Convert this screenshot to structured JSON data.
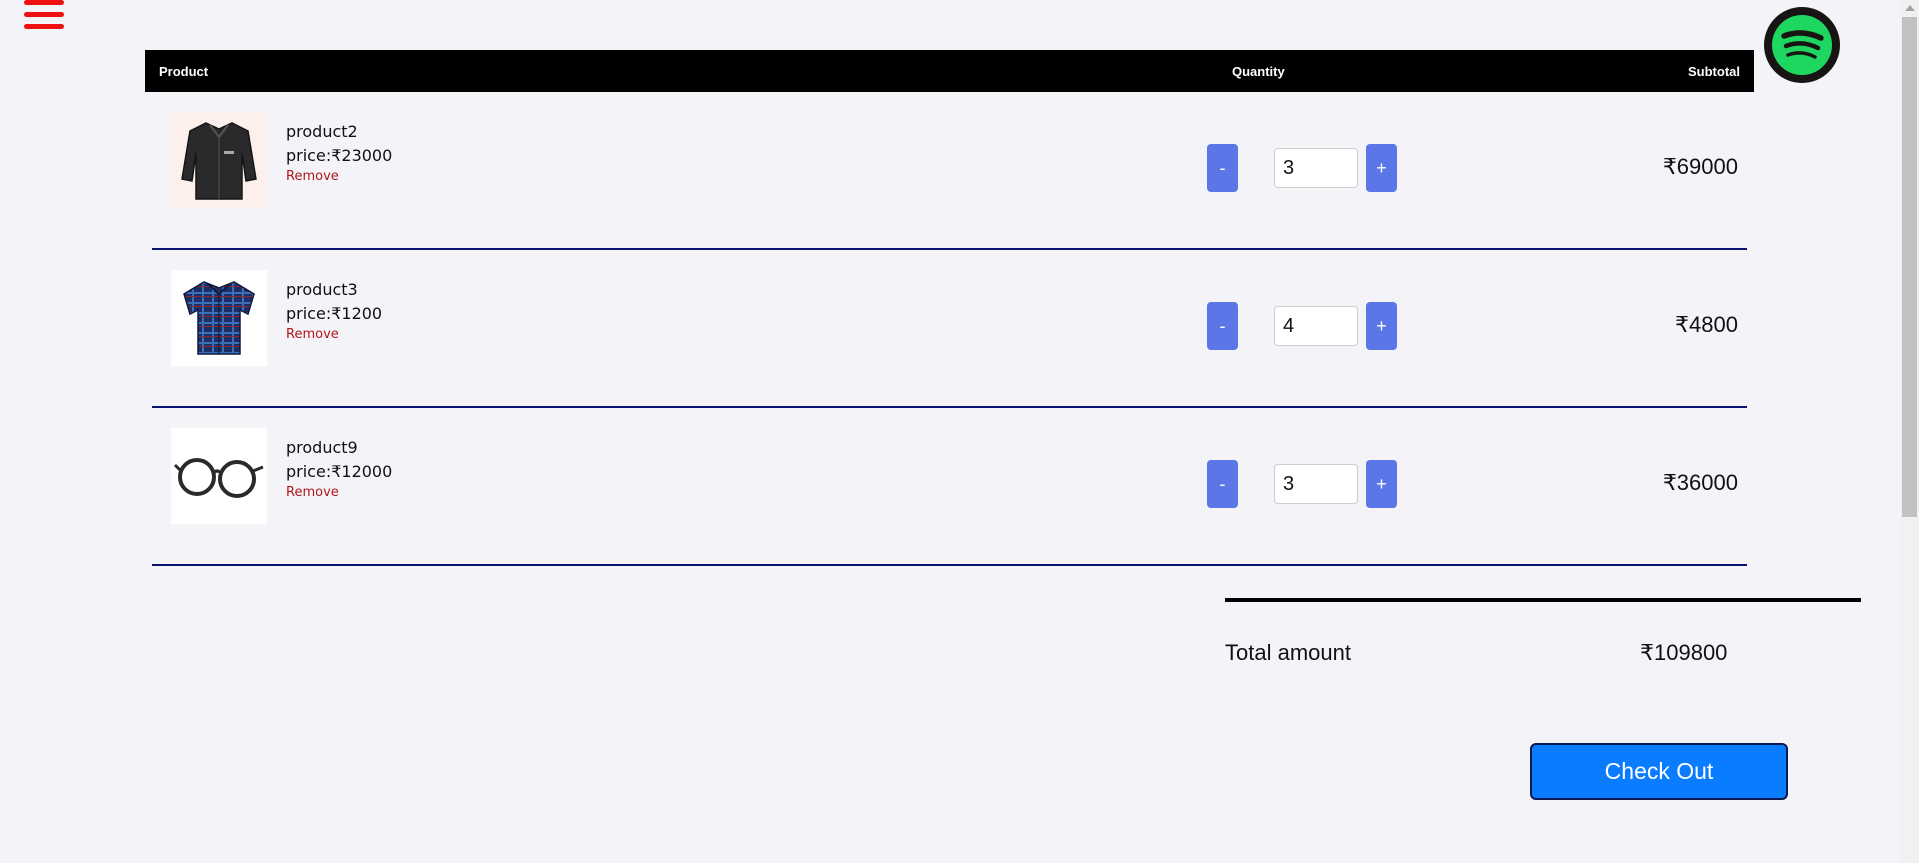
{
  "nav": {
    "menu_icon": "hamburger-menu-icon",
    "menu_color": "#ee1111",
    "spotify_icon": "spotify-logo-icon",
    "spotify_color": "#1ed760"
  },
  "table": {
    "headers": {
      "product": "Product",
      "quantity": "Quantity",
      "subtotal": "Subtotal"
    },
    "rows": [
      {
        "name": "product2",
        "price": "price:₹23000",
        "remove": "Remove",
        "image_icon": "jacket-image",
        "minus": "-",
        "plus": "+",
        "quantity": "3",
        "subtotal": "₹69000"
      },
      {
        "name": "product3",
        "price": "price:₹1200",
        "remove": "Remove",
        "image_icon": "plaid-shirt-image",
        "minus": "-",
        "plus": "+",
        "quantity": "4",
        "subtotal": "₹4800"
      },
      {
        "name": "product9",
        "price": "price:₹12000",
        "remove": "Remove",
        "image_icon": "eyeglasses-image",
        "minus": "-",
        "plus": "+",
        "quantity": "3",
        "subtotal": "₹36000"
      }
    ]
  },
  "totals": {
    "label": "Total amount",
    "value": "₹109800"
  },
  "checkout": {
    "label": "Check Out",
    "color": "#0a7cff"
  },
  "colors": {
    "qty_button": "#5b76e6",
    "remove_link": "#b01818",
    "row_divider": "#0a1470",
    "header_bg": "#000000",
    "page_bg": "#f3f3f8"
  }
}
